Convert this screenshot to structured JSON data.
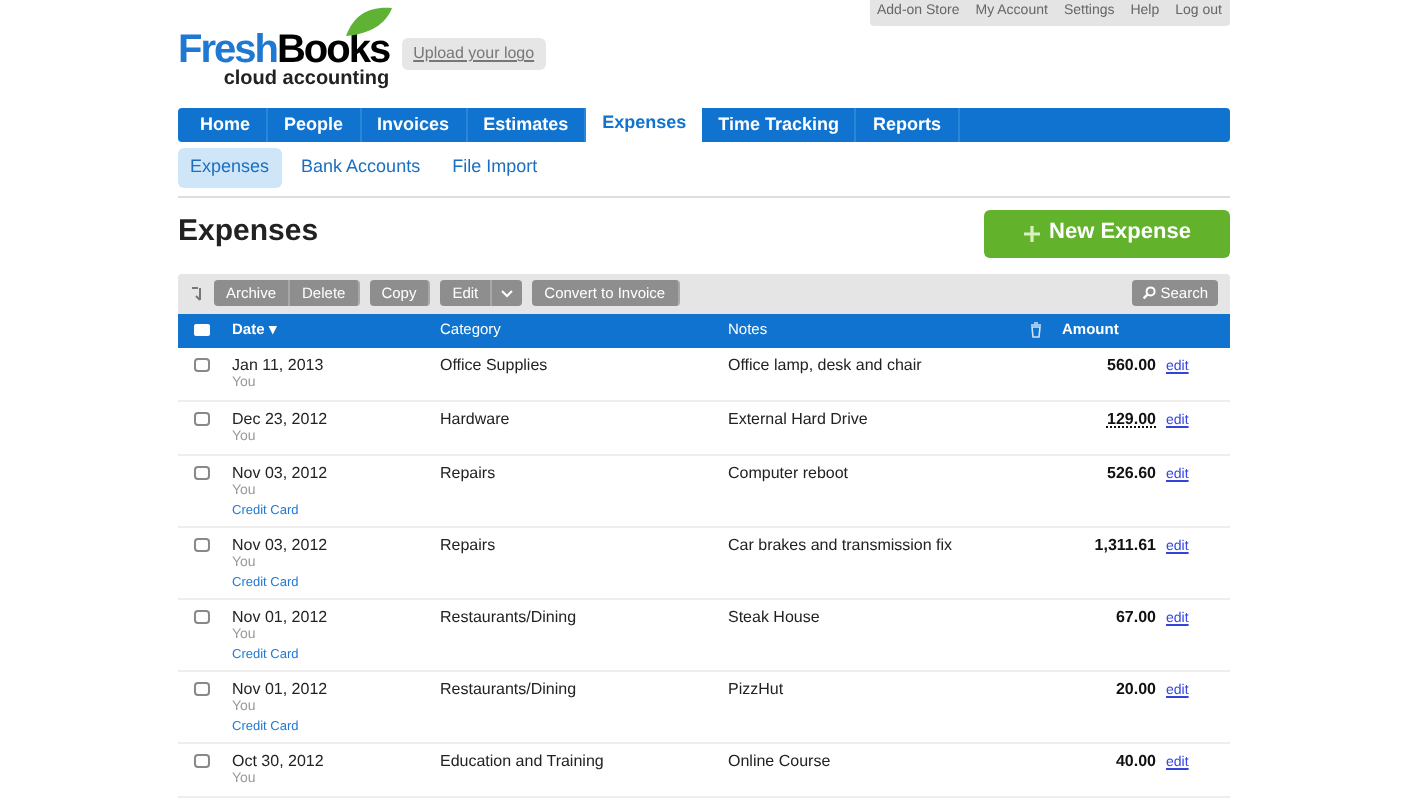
{
  "top_links": [
    "Add-on Store",
    "My Account",
    "Settings",
    "Help",
    "Log out"
  ],
  "logo": {
    "name_part1": "Fresh",
    "name_part2": "Books",
    "tagline": "cloud accounting"
  },
  "upload_logo": "Upload your logo",
  "nav": [
    {
      "label": "Home",
      "selected": false
    },
    {
      "label": "People",
      "selected": false
    },
    {
      "label": "Invoices",
      "selected": false
    },
    {
      "label": "Estimates",
      "selected": false
    },
    {
      "label": "Expenses",
      "selected": true
    },
    {
      "label": "Time Tracking",
      "selected": false
    },
    {
      "label": "Reports",
      "selected": false
    }
  ],
  "subnav": [
    {
      "label": "Expenses",
      "selected": true
    },
    {
      "label": "Bank Accounts",
      "selected": false
    },
    {
      "label": "File Import",
      "selected": false
    }
  ],
  "title": "Expenses",
  "new_button": "New Expense",
  "toolbar": {
    "groups": [
      {
        "buttons": [
          "Archive",
          "Delete"
        ]
      },
      {
        "buttons": [
          "Copy"
        ]
      },
      {
        "buttons": [
          "Edit"
        ],
        "dropdown": true
      },
      {
        "buttons": [
          "Convert to Invoice"
        ]
      }
    ],
    "search": "Search"
  },
  "columns": {
    "select_all_checked": false,
    "date": "Date",
    "sort_indicator": "▾",
    "category": "Category",
    "notes": "Notes",
    "amount": "Amount"
  },
  "rows": [
    {
      "checked": false,
      "date": "Jan 11, 2013",
      "user": "You",
      "category": "Office Supplies",
      "notes": "Office lamp, desk and chair",
      "amount": "560.00",
      "underlined": false,
      "action": "edit"
    },
    {
      "checked": false,
      "date": "Dec 23, 2012",
      "user": "You",
      "category": "Hardware",
      "notes": "External Hard Drive",
      "amount": "129.00",
      "underlined": true,
      "action": "edit"
    },
    {
      "checked": false,
      "date": "Nov 03, 2012",
      "user": "You",
      "payment": "Credit Card",
      "category": "Repairs",
      "notes": "Computer reboot",
      "amount": "526.60",
      "underlined": false,
      "action": "edit"
    },
    {
      "checked": false,
      "date": "Nov 03, 2012",
      "user": "You",
      "payment": "Credit Card",
      "category": "Repairs",
      "notes": "Car brakes and transmission fix",
      "amount": "1,311.61",
      "underlined": false,
      "action": "edit"
    },
    {
      "checked": false,
      "date": "Nov 01, 2012",
      "user": "You",
      "payment": "Credit Card",
      "category": "Restaurants/Dining",
      "notes": "Steak House",
      "amount": "67.00",
      "underlined": false,
      "action": "edit"
    },
    {
      "checked": false,
      "date": "Nov 01, 2012",
      "user": "You",
      "payment": "Credit Card",
      "category": "Restaurants/Dining",
      "notes": "PizzHut",
      "amount": "20.00",
      "underlined": false,
      "action": "edit"
    },
    {
      "checked": false,
      "date": "Oct 30, 2012",
      "user": "You",
      "category": "Education and Training",
      "notes": "Online Course",
      "amount": "40.00",
      "underlined": false,
      "action": "edit"
    }
  ]
}
